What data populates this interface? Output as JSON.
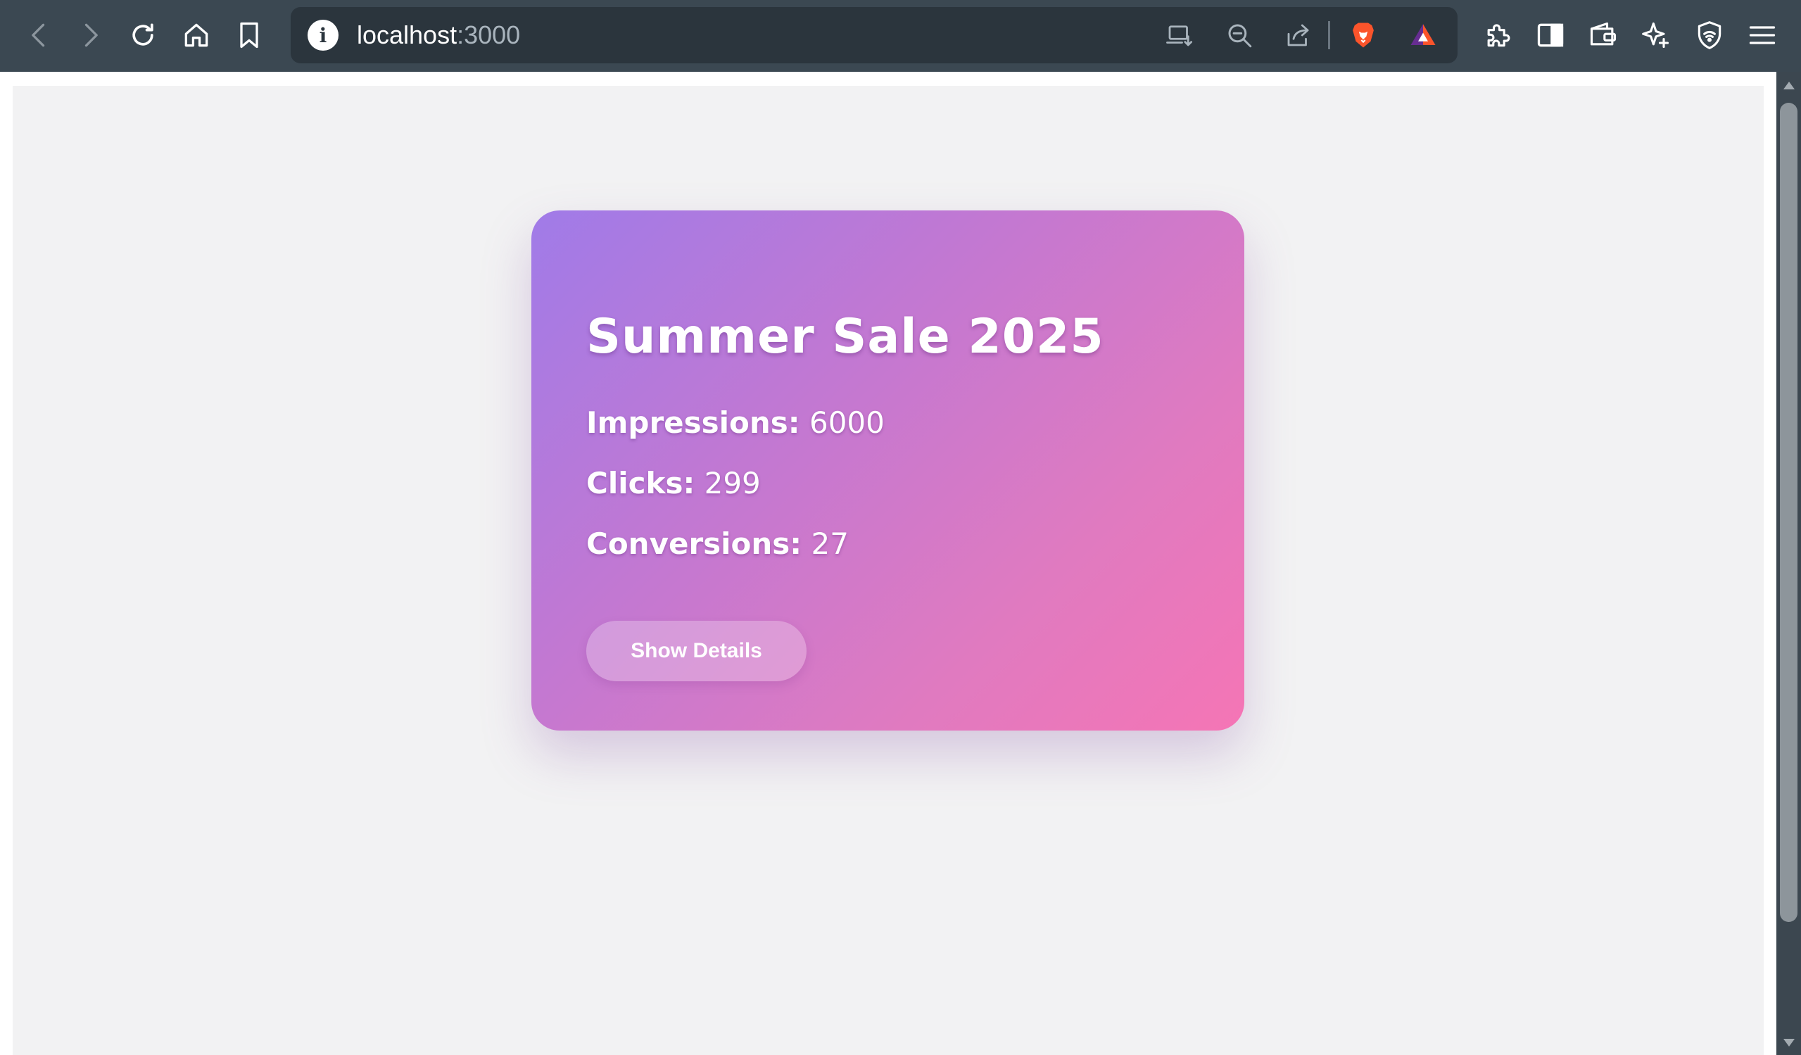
{
  "browser": {
    "url_host": "localhost",
    "url_port": ":3000",
    "nav_icons": [
      "back-icon",
      "forward-icon",
      "reload-icon",
      "home-icon",
      "bookmark-icon"
    ],
    "address_icons": [
      "install-app-icon",
      "zoom-out-icon",
      "share-icon",
      "brave-shields-icon",
      "brave-rewards-icon"
    ],
    "toolbar_icons": [
      "extensions-icon",
      "sidebar-icon",
      "wallet-icon",
      "leo-ai-icon",
      "vpn-icon",
      "menu-icon"
    ],
    "colors": {
      "toolbar": "#3b4852",
      "omnibox": "#2b353d",
      "brave_orange": "#fb542b"
    }
  },
  "card": {
    "title": "Summer Sale 2025",
    "stats": [
      {
        "label": "Impressions:",
        "value": "6000"
      },
      {
        "label": "Clicks:",
        "value": "299"
      },
      {
        "label": "Conversions:",
        "value": "27"
      }
    ],
    "button_label": "Show Details",
    "gradient": [
      "#a07be8",
      "#f575b5"
    ]
  },
  "page": {
    "background": "#f2f2f3"
  }
}
